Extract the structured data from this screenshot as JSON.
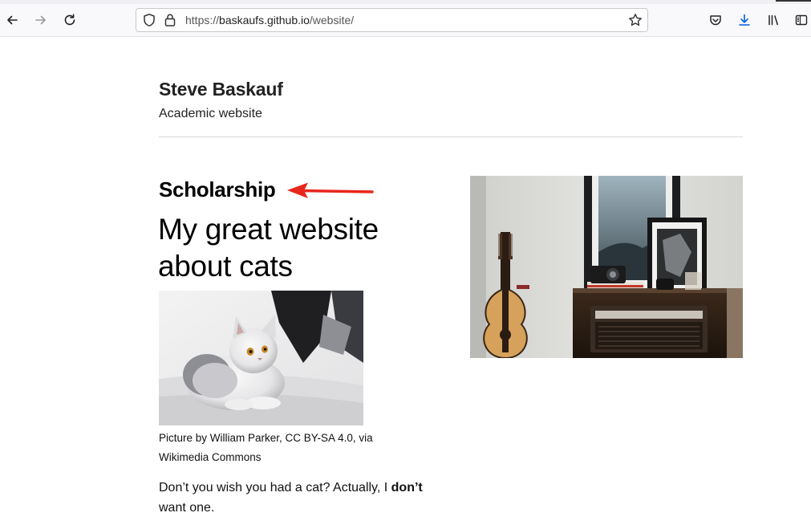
{
  "browser": {
    "url_prefix": "https://",
    "url_host": "baskaufs.github.io",
    "url_path": "/website/",
    "icons": [
      "back-arrow-icon",
      "forward-arrow-icon",
      "reload-icon",
      "shield-icon",
      "lock-icon",
      "star-icon",
      "pocket-icon",
      "download-icon",
      "library-icon",
      "sidebar-icon"
    ],
    "accent_color": "#0060df"
  },
  "header": {
    "site_title": "Steve Baskauf",
    "site_description": "Academic website"
  },
  "post": {
    "category": "Scholarship",
    "title": "My great website about cats",
    "image_caption": "Picture by William Parker, CC BY-SA 4.0, via Wikimedia Commons",
    "body_before_bold": "Don’t you wish you had a cat? Actually, I ",
    "body_bold": "don’t",
    "body_after_bold": " want one."
  },
  "annotation": {
    "arrow_color": "#e8261c"
  }
}
